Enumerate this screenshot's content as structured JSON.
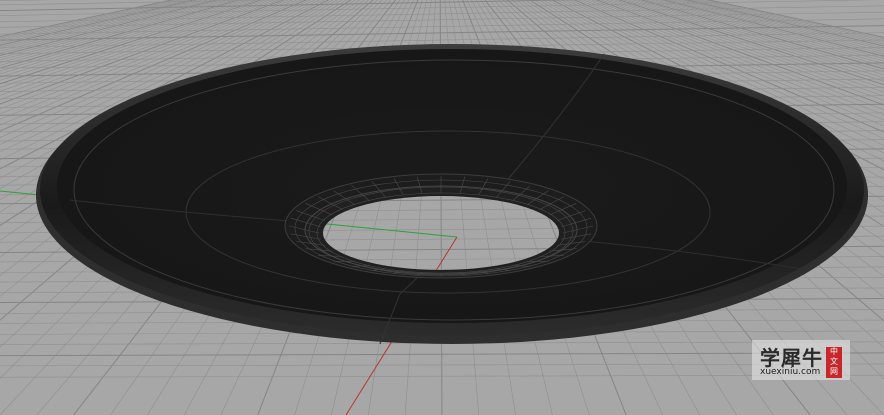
{
  "viewport": {
    "view": "perspective",
    "background_color": "#a7a7a7",
    "grid_color": "#8f8f8f",
    "grid_major_color": "#858585",
    "x_axis_color": "#b23a2f",
    "y_axis_color": "#2fa03a"
  },
  "model": {
    "object": "ring-disc",
    "shaded_color": "#1c1c1c",
    "rim_color": "#3a3a3a",
    "edge_color": "#4a4a4a"
  },
  "watermark": {
    "title": "学犀牛",
    "seal": [
      "中",
      "文",
      "网"
    ],
    "url": "xuexiniu.com",
    "seal_color": "#c8262b"
  }
}
